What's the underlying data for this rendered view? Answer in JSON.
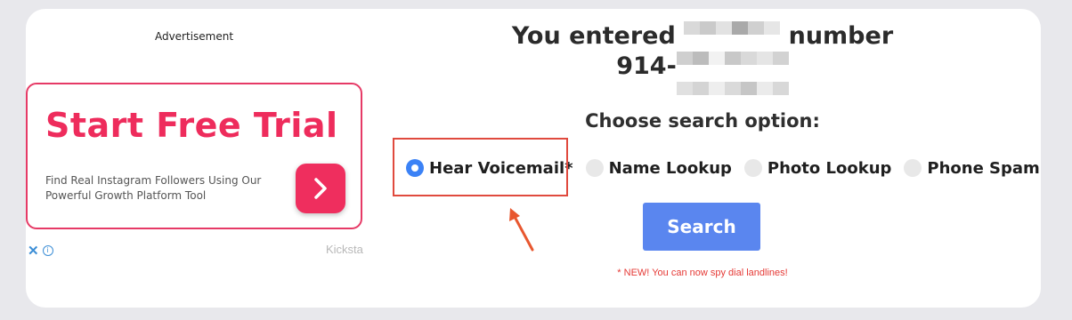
{
  "ad": {
    "label": "Advertisement",
    "headline": "Start Free Trial",
    "description": "Find Real Instagram Followers Using Our Powerful Growth Platform Tool",
    "sponsor": "Kicksta",
    "close_glyph": "✕",
    "info_glyph": "i",
    "accent_color": "#ee2c5c"
  },
  "heading": {
    "prefix": "You entered",
    "suffix": "number",
    "number_prefix": "914-"
  },
  "search": {
    "choose_label": "Choose search option:",
    "options": [
      {
        "label": "Hear Voicemail*",
        "selected": true
      },
      {
        "label": "Name Lookup",
        "selected": false
      },
      {
        "label": "Photo Lookup",
        "selected": false
      },
      {
        "label": "Phone Spam",
        "selected": false
      }
    ],
    "button_label": "Search",
    "notice": "* NEW! You can now spy dial landlines!",
    "button_color": "#5a86ef",
    "radio_selected_color": "#3b82f6",
    "highlight_color": "#e04a3e"
  }
}
